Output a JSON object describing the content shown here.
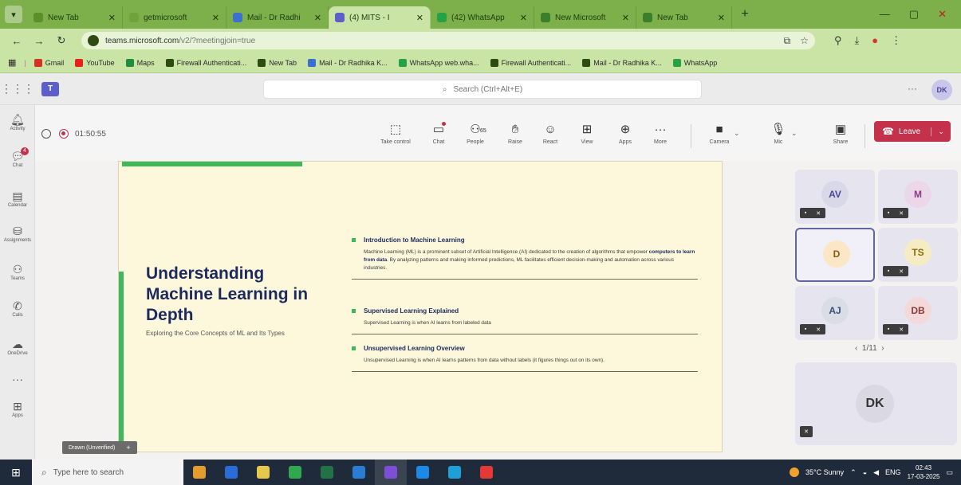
{
  "browser": {
    "tabs": [
      {
        "title": "New Tab",
        "color": "#5a8f2a",
        "active": false
      },
      {
        "title": "getmicrosoft",
        "color": "#6fa43a",
        "active": false
      },
      {
        "title": "Mail - Dr Radhi",
        "color": "#3b6fd0",
        "active": false
      },
      {
        "title": "(4) MITS - I",
        "color": "#5b5fc7",
        "active": true
      },
      {
        "title": "(42) WhatsApp",
        "color": "#25a244",
        "active": false
      },
      {
        "title": "New Microsoft",
        "color": "#3a7d2a",
        "active": false
      },
      {
        "title": "New Tab",
        "color": "#3a7d2a",
        "active": false
      }
    ],
    "url_host": "teams.microsoft.com",
    "url_path": "/v2/?meetingjoin=true",
    "bookmarks": [
      {
        "label": "Gmail",
        "color": "#d93025"
      },
      {
        "label": "YouTube",
        "color": "#e62117"
      },
      {
        "label": "Maps",
        "color": "#1e8e3e"
      },
      {
        "label": "Firewall Authenticati...",
        "color": "#2e4c12"
      },
      {
        "label": "New Tab",
        "color": "#2e4c12"
      },
      {
        "label": "Mail - Dr Radhika K...",
        "color": "#3b6fd0"
      },
      {
        "label": "WhatsApp web.wha...",
        "color": "#25a244"
      },
      {
        "label": "Firewall Authenticati...",
        "color": "#2e4c12"
      },
      {
        "label": "Mail - Dr Radhika K...",
        "color": "#2e4c12"
      },
      {
        "label": "WhatsApp",
        "color": "#25a244"
      }
    ]
  },
  "teams": {
    "search_placeholder": "Search (Ctrl+Alt+E)",
    "user_initials": "DK",
    "rail": [
      {
        "label": "Activity",
        "icon": "bell-icon"
      },
      {
        "label": "Chat",
        "icon": "chat-icon",
        "badge": "4"
      },
      {
        "label": "Calendar",
        "icon": "calendar-icon"
      },
      {
        "label": "Assignments",
        "icon": "assignments-icon"
      },
      {
        "label": "Teams",
        "icon": "teams-icon"
      },
      {
        "label": "Calls",
        "icon": "phone-icon"
      },
      {
        "label": "OneDrive",
        "icon": "cloud-icon"
      },
      {
        "label": "",
        "icon": "more-icon"
      },
      {
        "label": "Apps",
        "icon": "apps-icon"
      }
    ]
  },
  "meeting": {
    "timer": "01:50:55",
    "toolbar": [
      {
        "label": "Take control",
        "icon": "take-control-icon"
      },
      {
        "label": "Chat",
        "icon": "chat-icon"
      },
      {
        "label": "People",
        "icon": "people-icon",
        "count": "65"
      },
      {
        "label": "Raise",
        "icon": "raise-hand-icon"
      },
      {
        "label": "React",
        "icon": "react-icon"
      },
      {
        "label": "View",
        "icon": "view-icon"
      },
      {
        "label": "Apps",
        "icon": "apps-icon"
      },
      {
        "label": "More",
        "icon": "more-icon"
      },
      {
        "label": "Camera",
        "icon": "camera-off-icon"
      },
      {
        "label": "Mic",
        "icon": "mic-off-icon"
      },
      {
        "label": "Share",
        "icon": "share-icon"
      }
    ],
    "leave_label": "Leave"
  },
  "slide": {
    "title": "Understanding Machine Learning in Depth",
    "subtitle": "Exploring the Core Concepts of ML and Its Types",
    "sections": [
      {
        "heading": "Introduction to Machine Learning",
        "body_pre": "Machine Learning (ML) is a prominent subset of Artificial Intelligence (AI) dedicated to the creation of algorithms that empower ",
        "body_bold": "computers to learn from data",
        "body_post": ". By analyzing patterns and making informed predictions, ML facilitates efficient decision-making and automation across various industries."
      },
      {
        "heading": "Supervised Learning Explained",
        "body_pre": "Supervised Learning is when AI learns from labeled data",
        "body_bold": "",
        "body_post": ""
      },
      {
        "heading": "Unsupervised Learning Overview",
        "body_pre": "Unsupervised Learning is when AI learns patterns from data without labels (it figures things out on its own).",
        "body_bold": "",
        "body_post": ""
      }
    ],
    "drawn_label": "Drawn (Unverified)"
  },
  "participants": [
    {
      "initials": "AV",
      "bg": "#d9d8e8",
      "fg": "#4b4796"
    },
    {
      "initials": "M",
      "bg": "#ecd6ea",
      "fg": "#8c3b84"
    },
    {
      "initials": "D",
      "bg": "#fbe7c6",
      "fg": "#8a5a10"
    },
    {
      "initials": "TS",
      "bg": "#f5ecc4",
      "fg": "#8a6d10"
    },
    {
      "initials": "AJ",
      "bg": "#d9dde8",
      "fg": "#3b4e7a"
    },
    {
      "initials": "DB",
      "bg": "#f3d9d9",
      "fg": "#8c3b3b"
    }
  ],
  "pager": "1/11",
  "spotlight": {
    "initials": "DK"
  },
  "taskbar": {
    "search_placeholder": "Type here to search",
    "weather": "35°C  Sunny",
    "lang": "ENG",
    "time": "02:43",
    "date": "17-03-2025",
    "apps": [
      "#e69b2d",
      "#2b6cd6",
      "#e6c84a",
      "#2fa84f",
      "#217346",
      "#2b7cd3",
      "#7d4fd6",
      "#1e88e5",
      "#1e9fd6",
      "#e53935"
    ]
  }
}
